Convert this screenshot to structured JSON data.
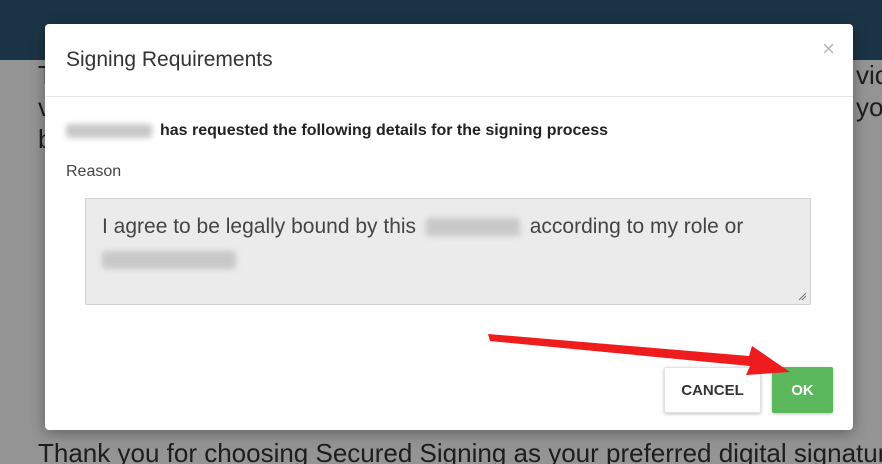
{
  "background": {
    "top_bar_color": "#2f5b78",
    "fragments": [
      "T",
      "v",
      "b",
      "vic",
      "yo"
    ],
    "bottom_text": "Thank you for choosing Secured Signing as your preferred digital signatur"
  },
  "modal": {
    "title": "Signing Requirements",
    "close_symbol": "×",
    "request_text": "has requested the following details for the signing process",
    "reason_label": "Reason",
    "reason_text_part1": "I agree to be legally bound by this",
    "reason_text_part2": "according to my role or",
    "cancel_label": "CANCEL",
    "ok_label": "OK"
  },
  "colors": {
    "ok_button": "#5cb85c",
    "annotation_arrow": "#ee1c1c",
    "overlay": "rgba(0,0,0,0.42)"
  },
  "icons": {
    "close": "close-icon",
    "resize": "resize-handle-icon",
    "annotation": "red-arrow-annotation"
  }
}
